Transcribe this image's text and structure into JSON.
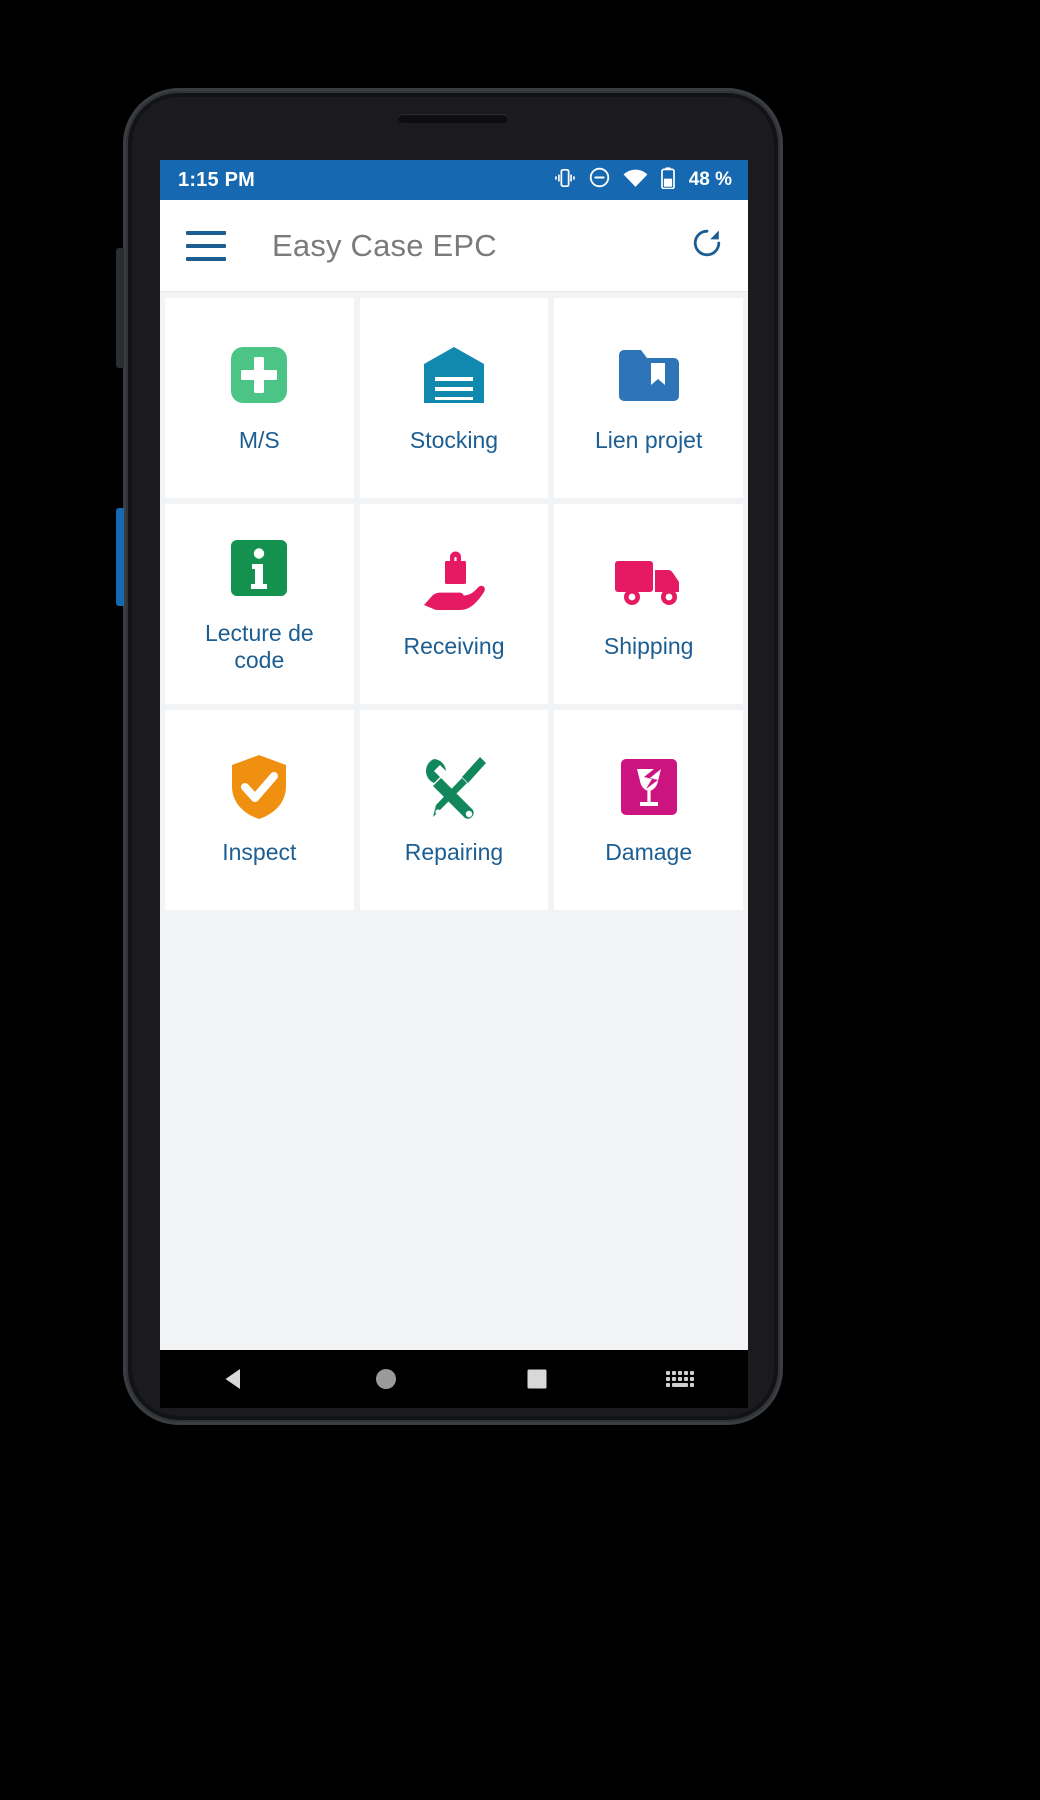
{
  "status_bar": {
    "time": "1:15 PM",
    "battery_text": "48 %",
    "icons": [
      "vibrate-icon",
      "do-not-disturb-icon",
      "wifi-icon",
      "battery-icon"
    ],
    "background_color": "#1668b0"
  },
  "app_bar": {
    "menu_icon": "hamburger-menu-icon",
    "title": "Easy Case EPC",
    "refresh_icon": "refresh-icon",
    "title_color": "#7b7b7b",
    "icon_color": "#1c5e92"
  },
  "tiles": [
    {
      "label": "M/S",
      "icon": "plus-square-icon",
      "color": "#4bc486"
    },
    {
      "label": "Stocking",
      "icon": "warehouse-icon",
      "color": "#1189ae"
    },
    {
      "label": "Lien projet",
      "icon": "folder-bookmark-icon",
      "color": "#2d74b8"
    },
    {
      "label": "Lecture de code",
      "icon": "info-square-icon",
      "color": "#15914f"
    },
    {
      "label": "Receiving",
      "icon": "hand-receive-package-icon",
      "color": "#e51a62"
    },
    {
      "label": "Shipping",
      "icon": "delivery-truck-icon",
      "color": "#e51a62"
    },
    {
      "label": "Inspect",
      "icon": "shield-check-icon",
      "color": "#ef9011"
    },
    {
      "label": "Repairing",
      "icon": "wrench-screwdriver-icon",
      "color": "#12875c"
    },
    {
      "label": "Damage",
      "icon": "broken-glass-square-icon",
      "color": "#cc1481"
    }
  ],
  "nav_bar": {
    "back_icon": "triangle-back-icon",
    "home_icon": "circle-home-icon",
    "recents_icon": "square-recents-icon",
    "keyboard_icon": "keyboard-icon"
  },
  "theme": {
    "label_color": "#1c5e92",
    "grid_background": "#f1f3f4",
    "tile_background": "#ffffff"
  }
}
